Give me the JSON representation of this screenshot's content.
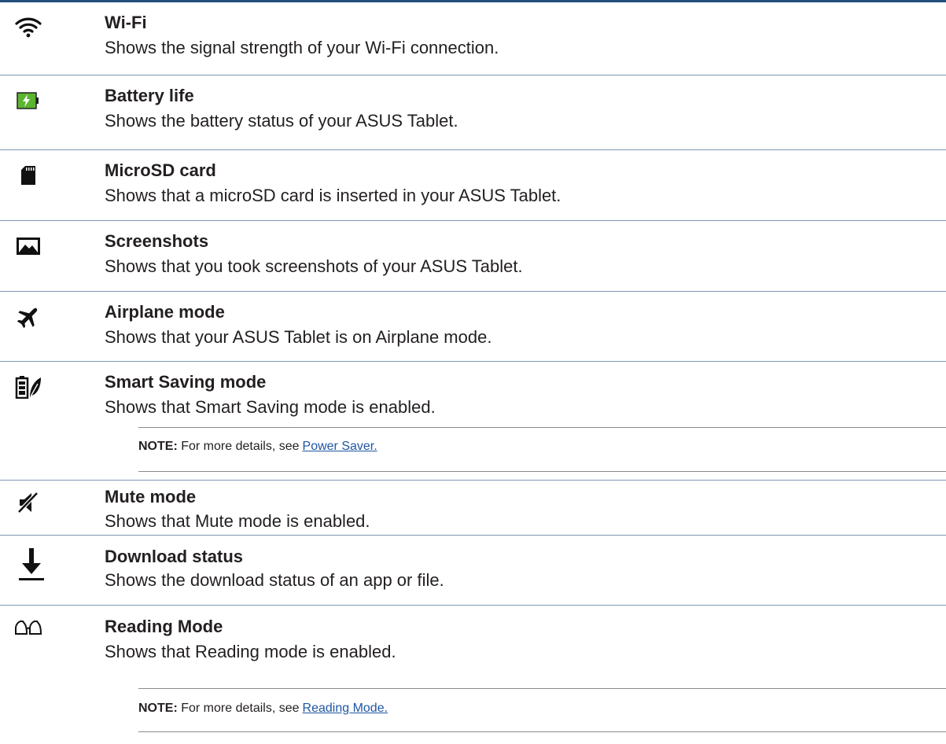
{
  "items": [
    {
      "icon": "wifi-icon",
      "title": "Wi-Fi",
      "desc": "Shows the signal strength of your Wi-Fi connection."
    },
    {
      "icon": "battery-charging-icon",
      "title": "Battery life",
      "desc": "Shows the battery status of your ASUS Tablet."
    },
    {
      "icon": "microsd-card-icon",
      "title": "MicroSD card",
      "desc": "Shows that a microSD card is inserted in your ASUS Tablet."
    },
    {
      "icon": "screenshot-icon",
      "title": "Screenshots",
      "desc": "Shows that you took screenshots of your ASUS Tablet."
    },
    {
      "icon": "airplane-icon",
      "title": "Airplane mode",
      "desc": "Shows that your ASUS Tablet is on Airplane mode."
    },
    {
      "icon": "smart-saving-icon",
      "title": "Smart Saving mode",
      "desc": "Shows that Smart Saving mode is enabled."
    },
    {
      "icon": "mute-icon",
      "title": "Mute mode",
      "desc": "Shows that Mute mode is enabled."
    },
    {
      "icon": "download-icon",
      "title": "Download status",
      "desc": "Shows the download status of an app or file."
    },
    {
      "icon": "reading-mode-icon",
      "title": "Reading Mode",
      "desc": "Shows that Reading mode is enabled."
    }
  ],
  "notes": [
    {
      "label": "NOTE:",
      "text": "For more details, see",
      "link": "Power Saver."
    },
    {
      "label": "NOTE:",
      "text": "For more details, see",
      "link": "Reading Mode."
    }
  ],
  "colors": {
    "rule": "#234f7d",
    "link": "#1f56a3",
    "battery_green": "#5cb531"
  }
}
